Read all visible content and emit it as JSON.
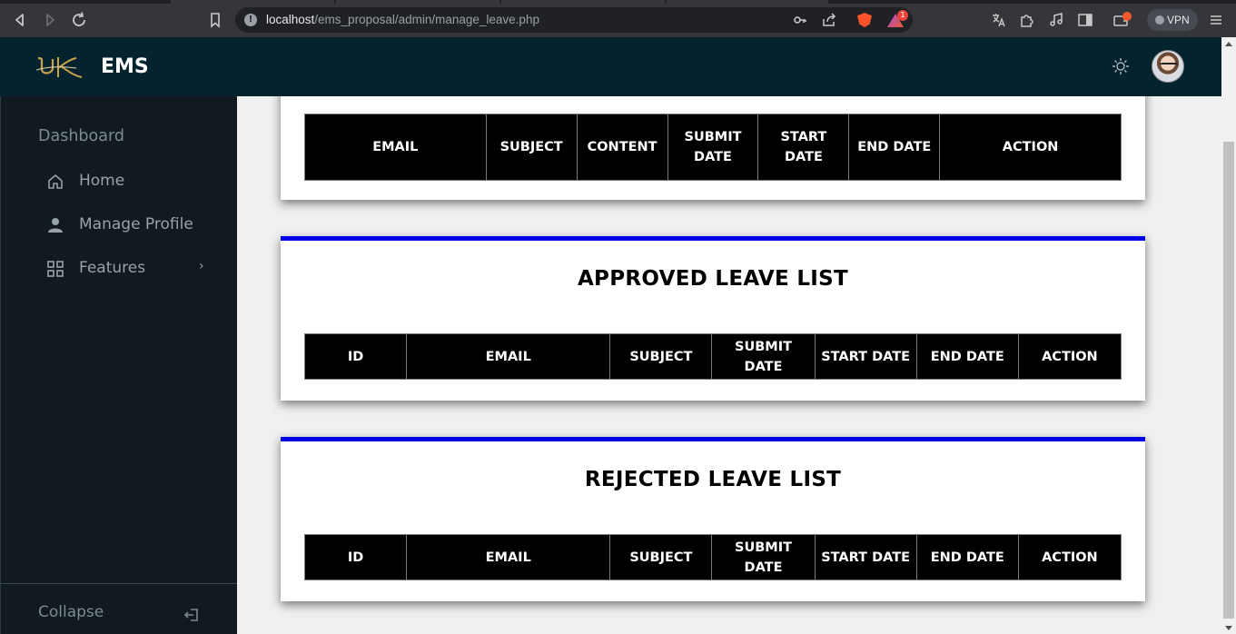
{
  "browser": {
    "url_host": "localhost",
    "url_path": "/ems_proposal/admin/manage_leave.php",
    "vpn_label": "VPN",
    "rewards_badge": "1"
  },
  "header": {
    "brand": "EMS",
    "logo_text": "UK"
  },
  "sidebar": {
    "title": "Dashboard",
    "items": [
      {
        "label": "Home",
        "icon": "home-icon"
      },
      {
        "label": "Manage Profile",
        "icon": "user-icon"
      },
      {
        "label": "Features",
        "icon": "grid-icon",
        "chevron": "›"
      }
    ],
    "collapse_label": "Collapse"
  },
  "pending_table": {
    "columns": [
      "EMAIL",
      "SUBJECT",
      "CONTENT",
      "SUBMIT DATE",
      "START DATE",
      "END DATE",
      "ACTION"
    ]
  },
  "approved": {
    "title": "APPROVED LEAVE LIST",
    "columns": [
      "ID",
      "EMAIL",
      "SUBJECT",
      "SUBMIT DATE",
      "START DATE",
      "END DATE",
      "ACTION"
    ]
  },
  "rejected": {
    "title": "REJECTED LEAVE LIST",
    "columns": [
      "ID",
      "EMAIL",
      "SUBJECT",
      "SUBMIT DATE",
      "START DATE",
      "END DATE",
      "ACTION"
    ]
  },
  "colors": {
    "header_bg": "#04232e",
    "sidebar_bg": "#111a1e",
    "card_accent": "#0000e6",
    "table_bg": "#000000"
  }
}
